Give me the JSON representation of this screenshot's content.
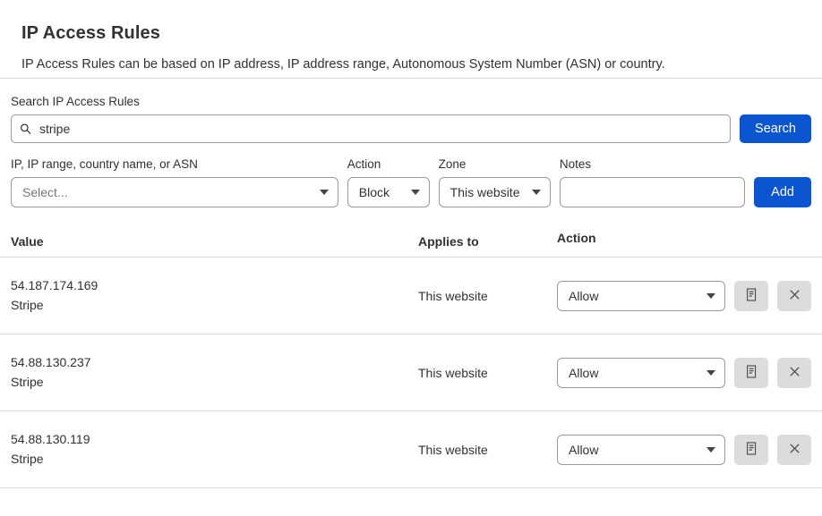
{
  "header": {
    "title": "IP Access Rules",
    "description": "IP Access Rules can be based on IP address, IP address range, Autonomous System Number (ASN) or country."
  },
  "search": {
    "label": "Search IP Access Rules",
    "value": "stripe",
    "placeholder": "",
    "icon": "search-icon",
    "button_label": "Search",
    "accent_color": "#0b55d0"
  },
  "add_rule": {
    "value_label": "IP, IP range, country name, or ASN",
    "value_placeholder": "Select...",
    "action_label": "Action",
    "action_value": "Block",
    "zone_label": "Zone",
    "zone_value": "This website",
    "notes_label": "Notes",
    "notes_value": "",
    "notes_placeholder": "",
    "add_button_label": "Add"
  },
  "table": {
    "columns": [
      "Value",
      "Applies to",
      "Action"
    ],
    "rows": [
      {
        "ip": "54.187.174.169",
        "note": "Stripe",
        "applies_to": "This website",
        "action": "Allow",
        "notes_icon": "notes-icon",
        "delete_icon": "close-icon"
      },
      {
        "ip": "54.88.130.237",
        "note": "Stripe",
        "applies_to": "This website",
        "action": "Allow",
        "notes_icon": "notes-icon",
        "delete_icon": "close-icon"
      },
      {
        "ip": "54.88.130.119",
        "note": "Stripe",
        "applies_to": "This website",
        "action": "Allow",
        "notes_icon": "notes-icon",
        "delete_icon": "close-icon"
      }
    ]
  }
}
